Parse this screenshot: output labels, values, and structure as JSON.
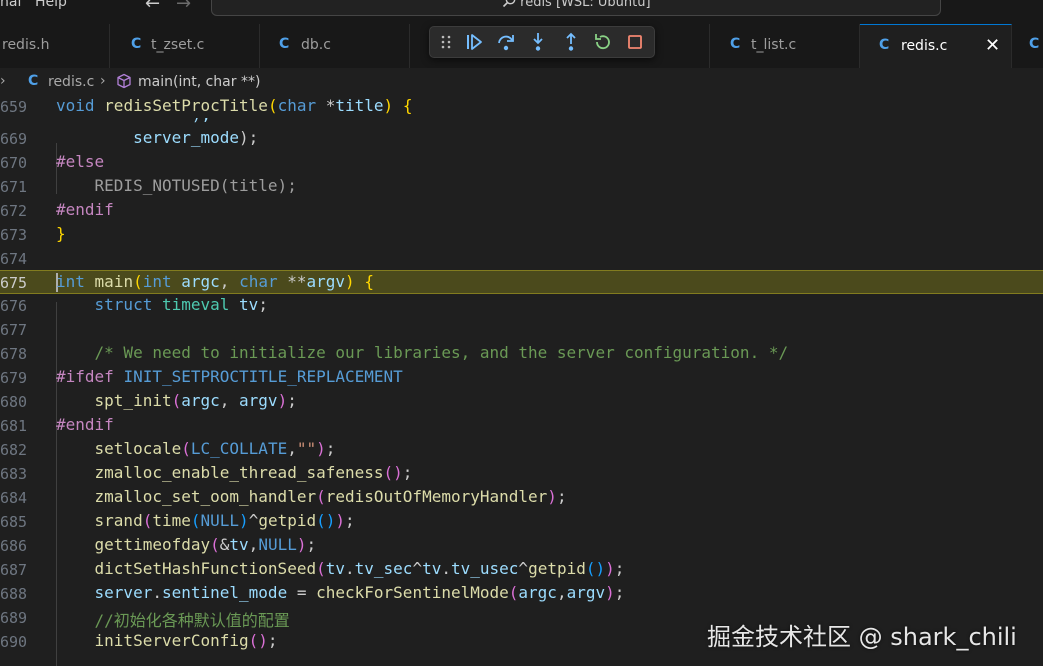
{
  "menu": {
    "partial_item": "nal",
    "help": "Help"
  },
  "command_center": {
    "text": "redis [WSL: Ubuntu]"
  },
  "tabs": [
    {
      "label": "redis.h"
    },
    {
      "label": "t_zset.c"
    },
    {
      "label": "db.c"
    },
    {
      "label": "t_list.c"
    },
    {
      "label": "redis.c"
    }
  ],
  "file_icon_letter": "C",
  "breadcrumb": {
    "file": "redis.c",
    "symbol": "main(int, char **)"
  },
  "debug_toolbar": [
    "continue",
    "step-over",
    "step-into",
    "step-out",
    "restart",
    "stop"
  ],
  "editor": {
    "line_numbers": [
      "659",
      "669",
      "670",
      "671",
      "672",
      "673",
      "674",
      "675",
      "676",
      "677",
      "678",
      "679",
      "680",
      "681",
      "682",
      "683",
      "684",
      "685",
      "686",
      "687",
      "688",
      "689",
      "690"
    ],
    "current_line": "675"
  },
  "colors": {
    "accent": "#0078d4",
    "highlight_line": "#4b4a1c",
    "icon_c": "#4fa0e8"
  },
  "watermark": "掘金技术社区 @ shark_chili"
}
